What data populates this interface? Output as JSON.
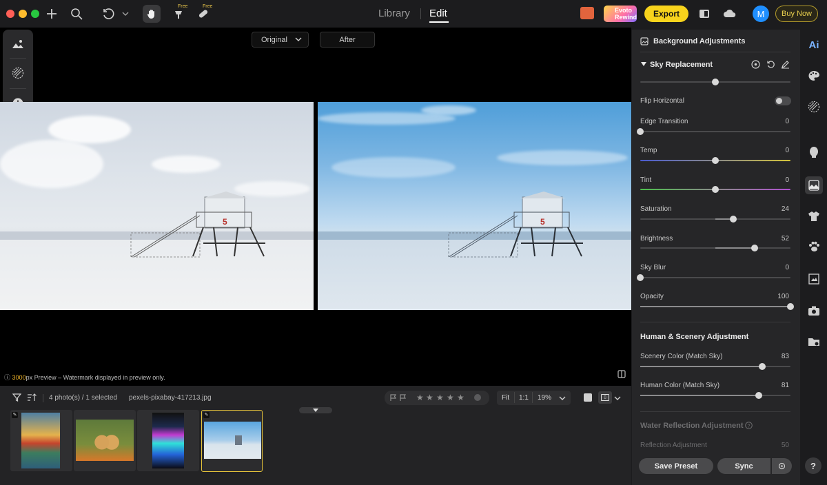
{
  "topbar": {
    "nav": {
      "library": "Library",
      "edit": "Edit"
    },
    "free_label_1": "Free",
    "free_label_2": "Free",
    "rewind_label_1": "Evoto",
    "rewind_label_2": "Rewind",
    "export_label": "Export",
    "avatar_initial": "M",
    "buy_label": "Buy Now",
    "icons": [
      "add-icon",
      "search-icon",
      "undo-icon",
      "hand-icon",
      "heal-icon",
      "bandage-icon",
      "gift-icon",
      "compare-panel-icon",
      "cloud-icon"
    ]
  },
  "canvas": {
    "compare_mode": "Original",
    "after_label": "After",
    "preview_note_highlight": "3000",
    "preview_note_rest": "px Preview – Watermark displayed in preview only.",
    "tower_number": "5"
  },
  "filmstrip": {
    "count_text": "4 photo(s) / 1 selected",
    "filename": "pexels-pixabay-417213.jpg",
    "stars": [
      "★",
      "★",
      "★",
      "★",
      "★"
    ],
    "zoom": {
      "fit": "Fit",
      "one_to_one": "1:1",
      "percent": "19%"
    },
    "thumbnails": [
      {
        "name": "colorful-building",
        "selected": false
      },
      {
        "name": "golden-puppies",
        "selected": false
      },
      {
        "name": "neon-tower",
        "selected": false
      },
      {
        "name": "beach-lifeguard-tower",
        "selected": true
      }
    ]
  },
  "panel": {
    "title": "Background Adjustments",
    "sky": {
      "title": "Sky Replacement",
      "top_slider": 50,
      "flip_label": "Flip Horizontal",
      "flip_on": false,
      "sliders": [
        {
          "label": "Edge Transition",
          "value": "0",
          "pos": 0
        },
        {
          "label": "Temp",
          "value": "0",
          "pos": 50
        },
        {
          "label": "Tint",
          "value": "0",
          "pos": 50
        },
        {
          "label": "Saturation",
          "value": "24",
          "pos": 62
        },
        {
          "label": "Brightness",
          "value": "52",
          "pos": 76
        },
        {
          "label": "Sky Blur",
          "value": "0",
          "pos": 0
        },
        {
          "label": "Opacity",
          "value": "100",
          "pos": 100
        }
      ]
    },
    "human": {
      "title": "Human & Scenery Adjustment",
      "sliders": [
        {
          "label": "Scenery Color (Match Sky)",
          "value": "83",
          "pos": 83
        },
        {
          "label": "Human Color (Match Sky)",
          "value": "81",
          "pos": 81
        }
      ]
    },
    "water": {
      "title": "Water Reflection Adjustment",
      "slider_label": "Reflection Adjustment",
      "slider_value": "50"
    },
    "save_preset": "Save Preset",
    "sync": "Sync"
  },
  "rail": {
    "ai_label": "Ai",
    "help": "?"
  },
  "colors": {
    "accent_yellow": "#f7d31c",
    "avatar_blue": "#1f8fff",
    "selection": "#e5c33a"
  }
}
